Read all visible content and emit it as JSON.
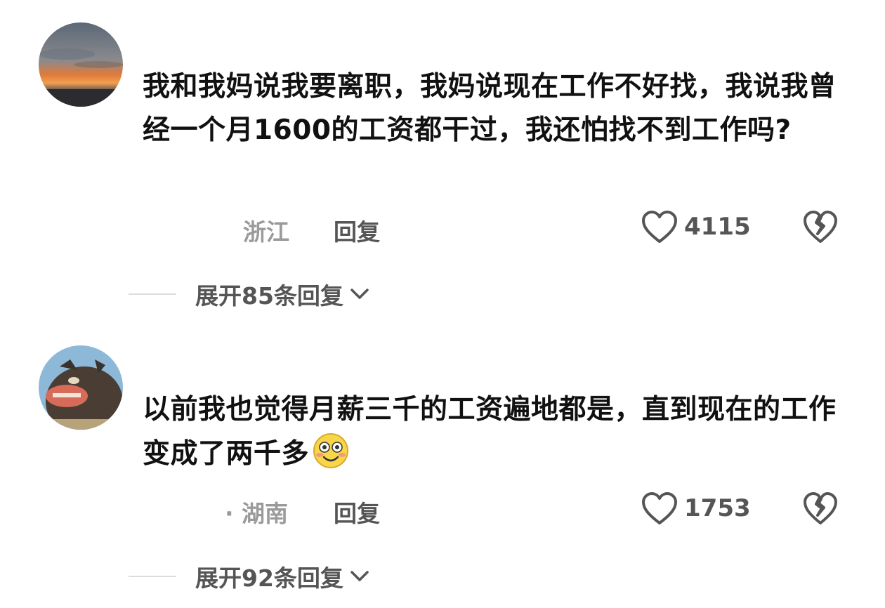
{
  "comments": [
    {
      "text": "我和我妈说我要离职，我妈说现在工作不好找，我说我曾经一个月1600的工资都干过，我还怕找不到工作吗?",
      "location": "浙江",
      "reply_label": "回复",
      "likes": "4115",
      "expand_label": "展开85条回复"
    },
    {
      "text": "以前我也觉得月薪三千的工资遍地都是，直到现在的工作变成了两千多",
      "location": "· 湖南",
      "reply_label": "回复",
      "likes": "1753",
      "expand_label": "展开92条回复"
    }
  ],
  "icons": [
    "heart-outline-icon",
    "broken-heart-icon",
    "chevron-down-icon",
    "smile-emoji-icon"
  ]
}
